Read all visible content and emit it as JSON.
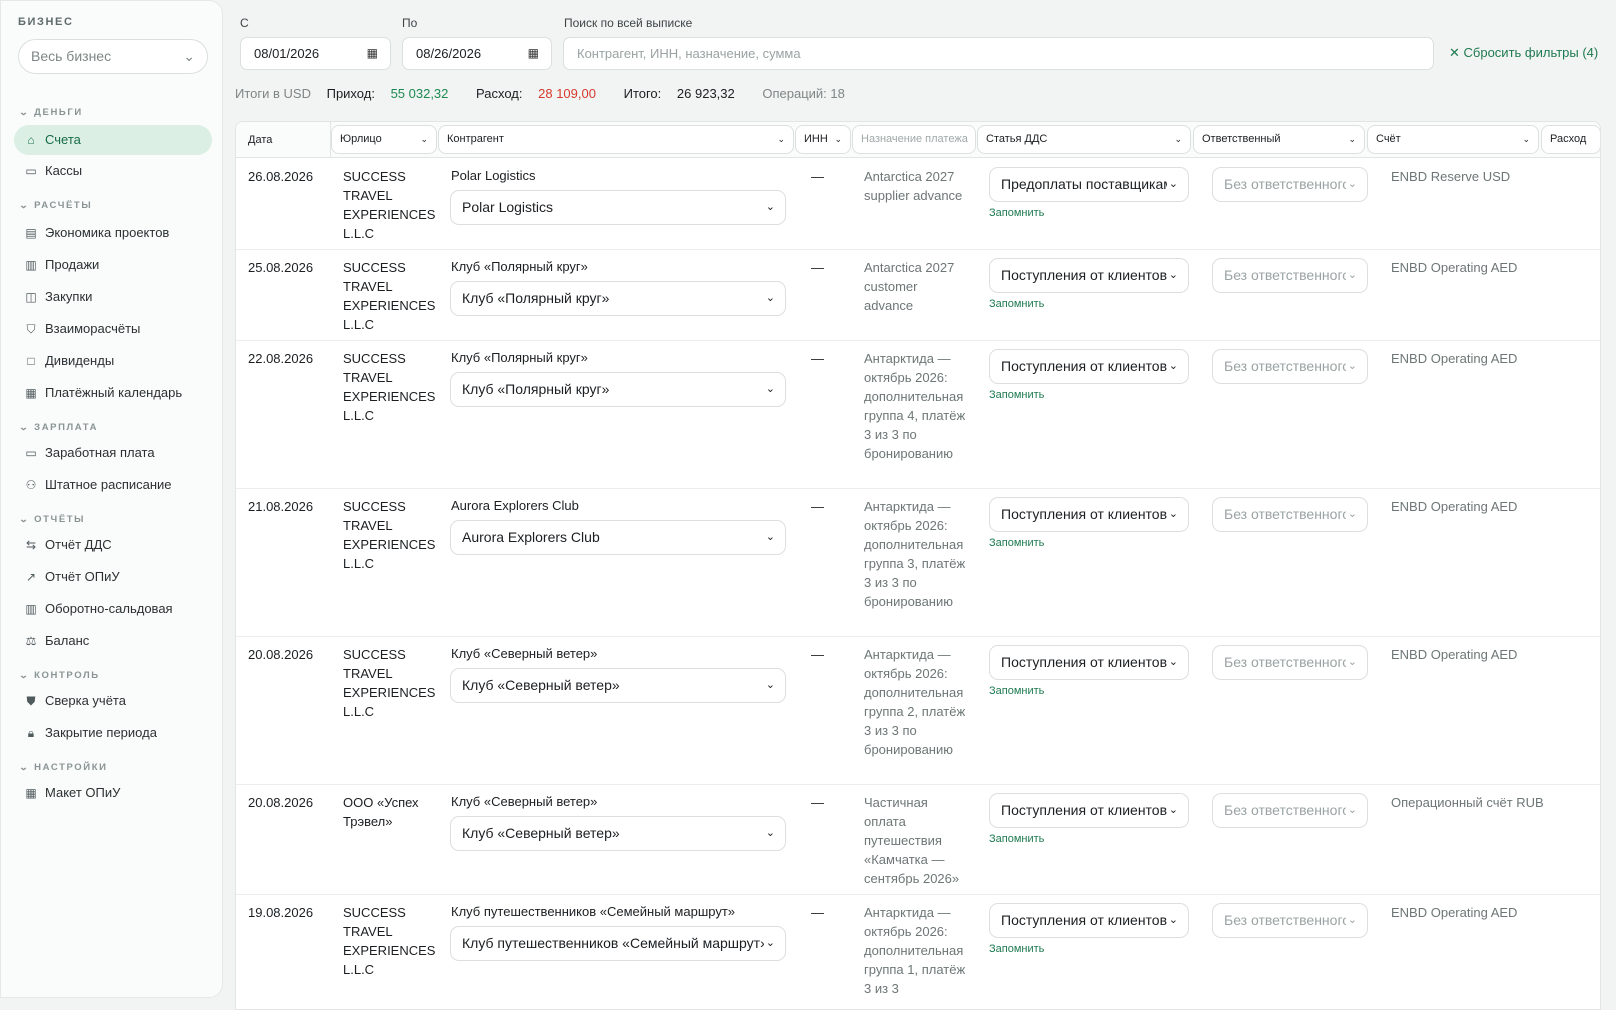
{
  "sidebar": {
    "business_label": "БИЗНЕС",
    "business_select": "Весь бизнес",
    "sections": [
      {
        "label": "ДЕНЬГИ"
      },
      {
        "label": "РАСЧЁТЫ"
      },
      {
        "label": "ЗАРПЛАТА"
      },
      {
        "label": "ОТЧЁТЫ"
      },
      {
        "label": "КОНТРОЛЬ"
      },
      {
        "label": "НАСТРОЙКИ"
      }
    ],
    "items": [
      {
        "label": "Счета",
        "icon": "bank-icon"
      },
      {
        "label": "Кассы",
        "icon": "cash-register-icon"
      },
      {
        "label": "Экономика проектов",
        "icon": "folder-icon"
      },
      {
        "label": "Продажи",
        "icon": "receipt-icon"
      },
      {
        "label": "Закупки",
        "icon": "shopping-bag-icon"
      },
      {
        "label": "Взаиморасчёты",
        "icon": "handshake-icon"
      },
      {
        "label": "Дивиденды",
        "icon": "square-icon"
      },
      {
        "label": "Платёжный календарь",
        "icon": "calendar-icon"
      },
      {
        "label": "Заработная плата",
        "icon": "banknote-icon"
      },
      {
        "label": "Штатное расписание",
        "icon": "users-icon"
      },
      {
        "label": "Отчёт ДДС",
        "icon": "arrows-exchange-icon"
      },
      {
        "label": "Отчёт ОПиУ",
        "icon": "trending-up-icon"
      },
      {
        "label": "Оборотно-сальдовая",
        "icon": "columns-icon"
      },
      {
        "label": "Баланс",
        "icon": "scale-icon"
      },
      {
        "label": "Сверка учёта",
        "icon": "shield-check-icon"
      },
      {
        "label": "Закрытие периода",
        "icon": "lock-icon"
      },
      {
        "label": "Макет ОПиУ",
        "icon": "table-icon"
      }
    ]
  },
  "filters": {
    "from_label": "С",
    "from_value": "08/01/2026",
    "to_label": "По",
    "to_value": "08/26/2026",
    "search_label": "Поиск по всей выписке",
    "search_placeholder": "Контрагент, ИНН, назначение, сумма",
    "reset_label": "Сбросить фильтры (4)"
  },
  "totals": {
    "currency_label": "Итоги в USD",
    "income_label": "Приход:",
    "income_value": "55 032,32",
    "expense_label": "Расход:",
    "expense_value": "28 109,00",
    "total_label": "Итого:",
    "total_value": "26 923,32",
    "ops_label": "Операций: 18"
  },
  "colors": {
    "accent": "#1e7a50",
    "income": "#1b8a50",
    "expense": "#d63a2e",
    "active_bg": "#dcefe4"
  },
  "table": {
    "headers": {
      "date": "Дата",
      "entity": "Юрлицо",
      "counterparty": "Контрагент",
      "inn": "ИНН",
      "purpose": "Назначение платежа",
      "dds": "Статья ДДС",
      "responsible": "Ответственный",
      "account": "Счёт",
      "expense": "Расход"
    },
    "remember_label": "Запомнить",
    "rows": [
      {
        "date": "26.08.2026",
        "entity": "SUCCESS TRAVEL EXPERIENCES L.L.C",
        "cp_name": "Polar Logistics",
        "cp_select": "Polar Logistics",
        "inn": "—",
        "purpose": "Antarctica 2027 supplier advance",
        "dds": "Предоплаты поставщикам",
        "responsible": "Без ответственного",
        "account": "ENBD Reserve USD"
      },
      {
        "date": "25.08.2026",
        "entity": "SUCCESS TRAVEL EXPERIENCES L.L.C",
        "cp_name": "Клуб «Полярный круг»",
        "cp_select": "Клуб «Полярный круг»",
        "inn": "—",
        "purpose": "Antarctica 2027 customer advance",
        "dds": "Поступления от клиентов",
        "responsible": "Без ответственного",
        "account": "ENBD Operating AED"
      },
      {
        "date": "22.08.2026",
        "entity": "SUCCESS TRAVEL EXPERIENCES L.L.C",
        "cp_name": "Клуб «Полярный круг»",
        "cp_select": "Клуб «Полярный круг»",
        "inn": "—",
        "purpose": "Антарктида — октябрь 2026: дополнительная группа 4, платёж 3 из 3 по бронированию",
        "dds": "Поступления от клиентов",
        "responsible": "Без ответственного",
        "account": "ENBD Operating AED"
      },
      {
        "date": "21.08.2026",
        "entity": "SUCCESS TRAVEL EXPERIENCES L.L.C",
        "cp_name": "Aurora Explorers Club",
        "cp_select": "Aurora Explorers Club",
        "inn": "—",
        "purpose": "Антарктида — октябрь 2026: дополнительная группа 3, платёж 3 из 3 по бронированию",
        "dds": "Поступления от клиентов",
        "responsible": "Без ответственного",
        "account": "ENBD Operating AED"
      },
      {
        "date": "20.08.2026",
        "entity": "SUCCESS TRAVEL EXPERIENCES L.L.C",
        "cp_name": "Клуб «Северный ветер»",
        "cp_select": "Клуб «Северный ветер»",
        "inn": "—",
        "purpose": "Антарктида — октябрь 2026: дополнительная группа 2, платёж 3 из 3 по бронированию",
        "dds": "Поступления от клиентов",
        "responsible": "Без ответственного",
        "account": "ENBD Operating AED"
      },
      {
        "date": "20.08.2026",
        "entity": "ООО «Успех Трэвел»",
        "cp_name": "Клуб «Северный ветер»",
        "cp_select": "Клуб «Северный ветер»",
        "inn": "—",
        "purpose": "Частичная оплата путешествия «Камчатка — сентябрь 2026»",
        "dds": "Поступления от клиентов",
        "responsible": "Без ответственного",
        "account": "Операционный счёт RUB"
      },
      {
        "date": "19.08.2026",
        "entity": "SUCCESS TRAVEL EXPERIENCES L.L.C",
        "cp_name": "Клуб путешественников «Семейный маршрут»",
        "cp_select": "Клуб путешественников «Семейный маршрут»",
        "inn": "—",
        "purpose": "Антарктида — октябрь 2026: дополнительная группа 1, платёж 3 из 3",
        "dds": "Поступления от клиентов",
        "responsible": "Без ответственного",
        "account": "ENBD Operating AED"
      }
    ]
  }
}
